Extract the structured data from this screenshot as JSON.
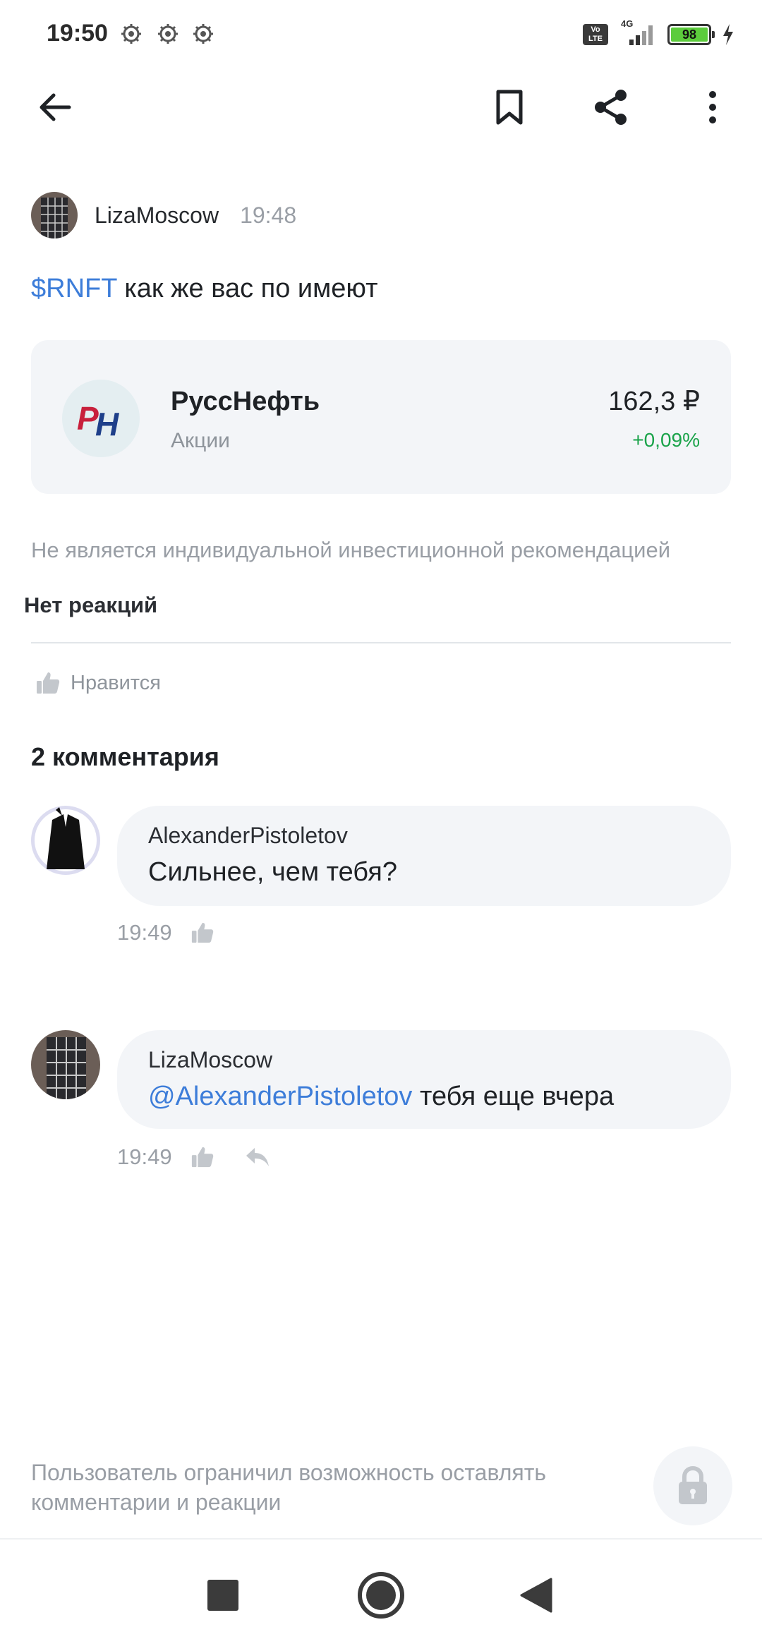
{
  "status_bar": {
    "time": "19:50",
    "network": "4G",
    "volte": "Vo LTE",
    "battery": "98",
    "icons": [
      "gear-icon",
      "gear-icon",
      "gear-icon",
      "signal-icon",
      "battery-icon",
      "charging-icon"
    ]
  },
  "toolbar": {
    "back_icon": "arrow-left-icon",
    "bookmark_icon": "bookmark-icon",
    "share_icon": "share-icon",
    "more_icon": "more-vertical-icon"
  },
  "post": {
    "author": "LizaMoscow",
    "time": "19:48",
    "ticker": "$RNFT",
    "text": " как же вас по имеют",
    "instrument": {
      "name": "РуссНефть",
      "type": "Акции",
      "price": "162,3 ₽",
      "change": "+0,09%",
      "logo_text": "PH"
    },
    "disclaimer": "Не является индивидуальной инвестиционной рекомендацией",
    "reactions_label": "Нет реакций",
    "like_label": "Нравится"
  },
  "comments": {
    "count_label": "2 комментария",
    "items": [
      {
        "author": "AlexanderPistoletov",
        "mention": "",
        "text": "Сильнее, чем тебя?",
        "time": "19:49"
      },
      {
        "author": "LizaMoscow",
        "mention": "@AlexanderPistoletov",
        "text": " тебя еще вчера",
        "time": "19:49"
      }
    ]
  },
  "footer": {
    "restriction_text": "Пользователь ограничил возможность оставлять комментарии и реакции"
  },
  "colors": {
    "accent": "#3d7dd9",
    "positive": "#1aa34a",
    "card_bg": "#f3f5f8",
    "logo_red": "#c8203c",
    "logo_blue": "#1e3f8a"
  }
}
